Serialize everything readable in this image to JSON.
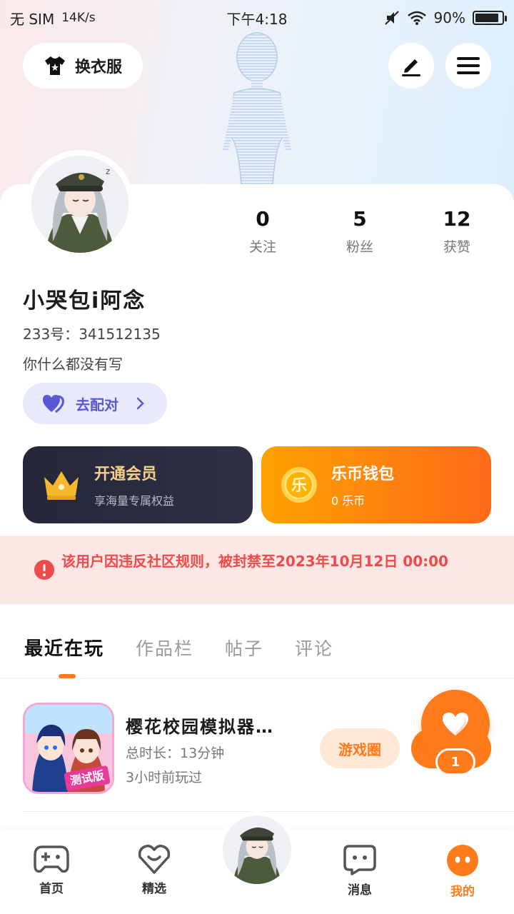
{
  "status_bar": {
    "carrier": "无 SIM",
    "speed": "14K/s",
    "time": "下午4:18",
    "battery": "90%",
    "battery_level": 0.9
  },
  "header": {
    "outfit_label": "换衣服"
  },
  "profile": {
    "username": "小哭包i阿念",
    "uid_label": "233号：",
    "uid_value": "341512135",
    "bio": "你什么都没有写",
    "match_label": "去配对"
  },
  "stats": [
    {
      "value": "0",
      "label": "关注"
    },
    {
      "value": "5",
      "label": "粉丝"
    },
    {
      "value": "12",
      "label": "获赞"
    }
  ],
  "vip_card": {
    "title": "开通会员",
    "subtitle": "享海量专属权益"
  },
  "wallet_card": {
    "badge": "乐",
    "title": "乐币钱包",
    "subtitle": "0 乐币"
  },
  "ban_notice": {
    "text": "该用户因违反社区规则，被封禁至2023年10月12日 00:00"
  },
  "tabs": [
    {
      "label": "最近在玩",
      "active": true
    },
    {
      "label": "作品栏",
      "active": false
    },
    {
      "label": "帖子",
      "active": false
    },
    {
      "label": "评论",
      "active": false
    }
  ],
  "game": {
    "title": "樱花校园模拟器…",
    "play_time": "总时长：13分钟",
    "last_played": "3小时前玩过",
    "badge_text": "测试版",
    "circle_button": "游戏圈"
  },
  "like": {
    "count": "1"
  },
  "bottom_nav": [
    {
      "label": "首页",
      "icon": "gamepad-icon",
      "active": false
    },
    {
      "label": "精选",
      "icon": "heart-box-icon",
      "active": false
    },
    {
      "label": "",
      "icon": "avatar",
      "active": false
    },
    {
      "label": "消息",
      "icon": "message-icon",
      "active": false
    },
    {
      "label": "我的",
      "icon": "profile-face-icon",
      "active": true
    }
  ],
  "colors": {
    "accent": "#ff7a1a",
    "ban_text": "#ee4b4b",
    "ban_bg": "#fce7e5",
    "match": "#5a58d6"
  }
}
